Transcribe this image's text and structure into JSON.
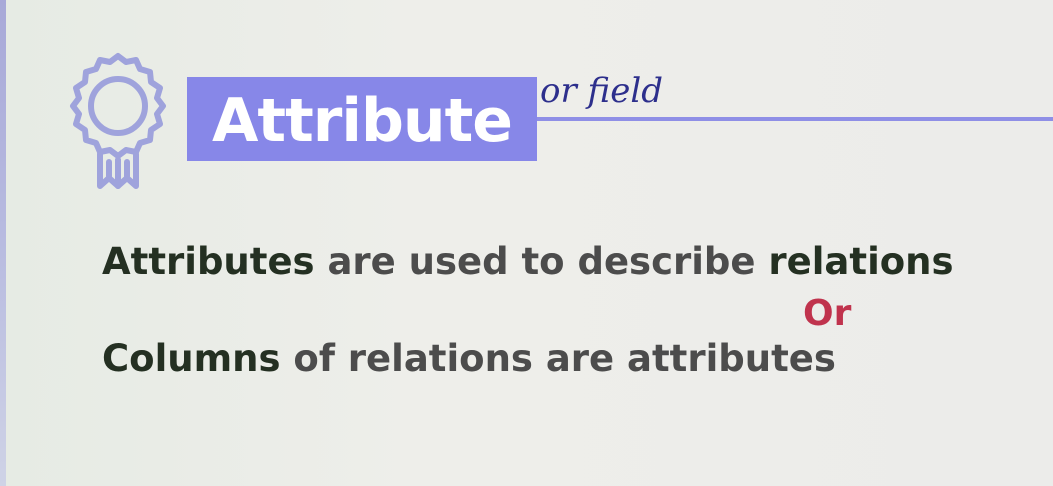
{
  "slide": {
    "title": "Attribute",
    "handwritten_note": "or field",
    "icon": "award-ribbon-icon",
    "line1": {
      "part1": "Attributes",
      "part2": " are used to describe ",
      "part3": "relations"
    },
    "separator": "Or",
    "line2": {
      "part1": "Columns",
      "part2": " of relations are attributes"
    }
  },
  "colors": {
    "title_box": "#8787e8",
    "title_text": "#ffffff",
    "rule": "#8f8fe6",
    "icon_stroke": "#9fa3dc",
    "body_text": "#4c4c4c",
    "emphasis_text": "#243022",
    "separator_text": "#c0334d",
    "handwriting_ink": "#2d2f8c"
  }
}
